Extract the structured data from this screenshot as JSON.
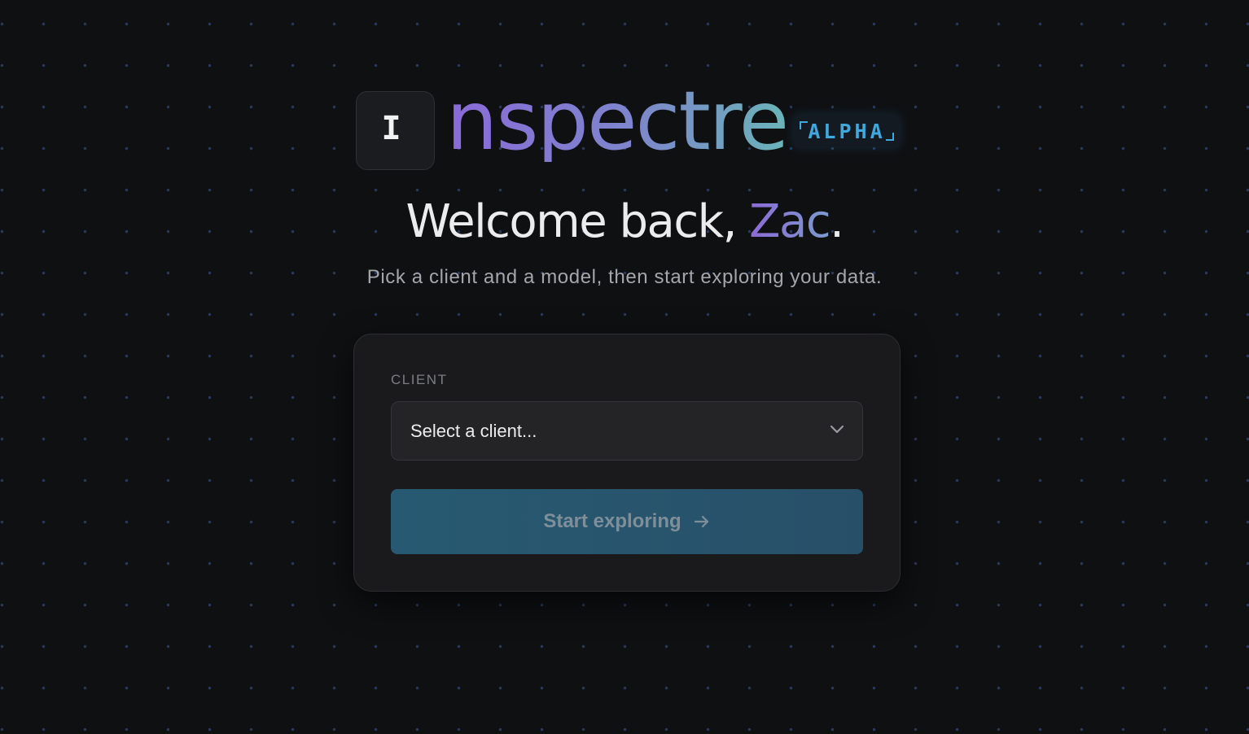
{
  "brand": {
    "logo_letter": "I",
    "wordmark": "nspectre",
    "badge": "ALPHA"
  },
  "welcome": {
    "greeting": "Welcome back, ",
    "name": "Zac",
    "punctuation": "."
  },
  "subtitle": "Pick a client and a model, then start exploring your data.",
  "form": {
    "client_label": "CLIENT",
    "client_select_value": "Select a client...",
    "start_button_label": "Start exploring"
  },
  "icons": {
    "select_chevron": "chevron-down-icon",
    "start_arrow": "arrow-right-icon"
  },
  "colors": {
    "background": "#0f1012",
    "accent_purple": "#8a6ad8",
    "accent_teal": "#6ab4b8",
    "badge_blue": "#3ea9df",
    "button_bg": "#275a72"
  }
}
